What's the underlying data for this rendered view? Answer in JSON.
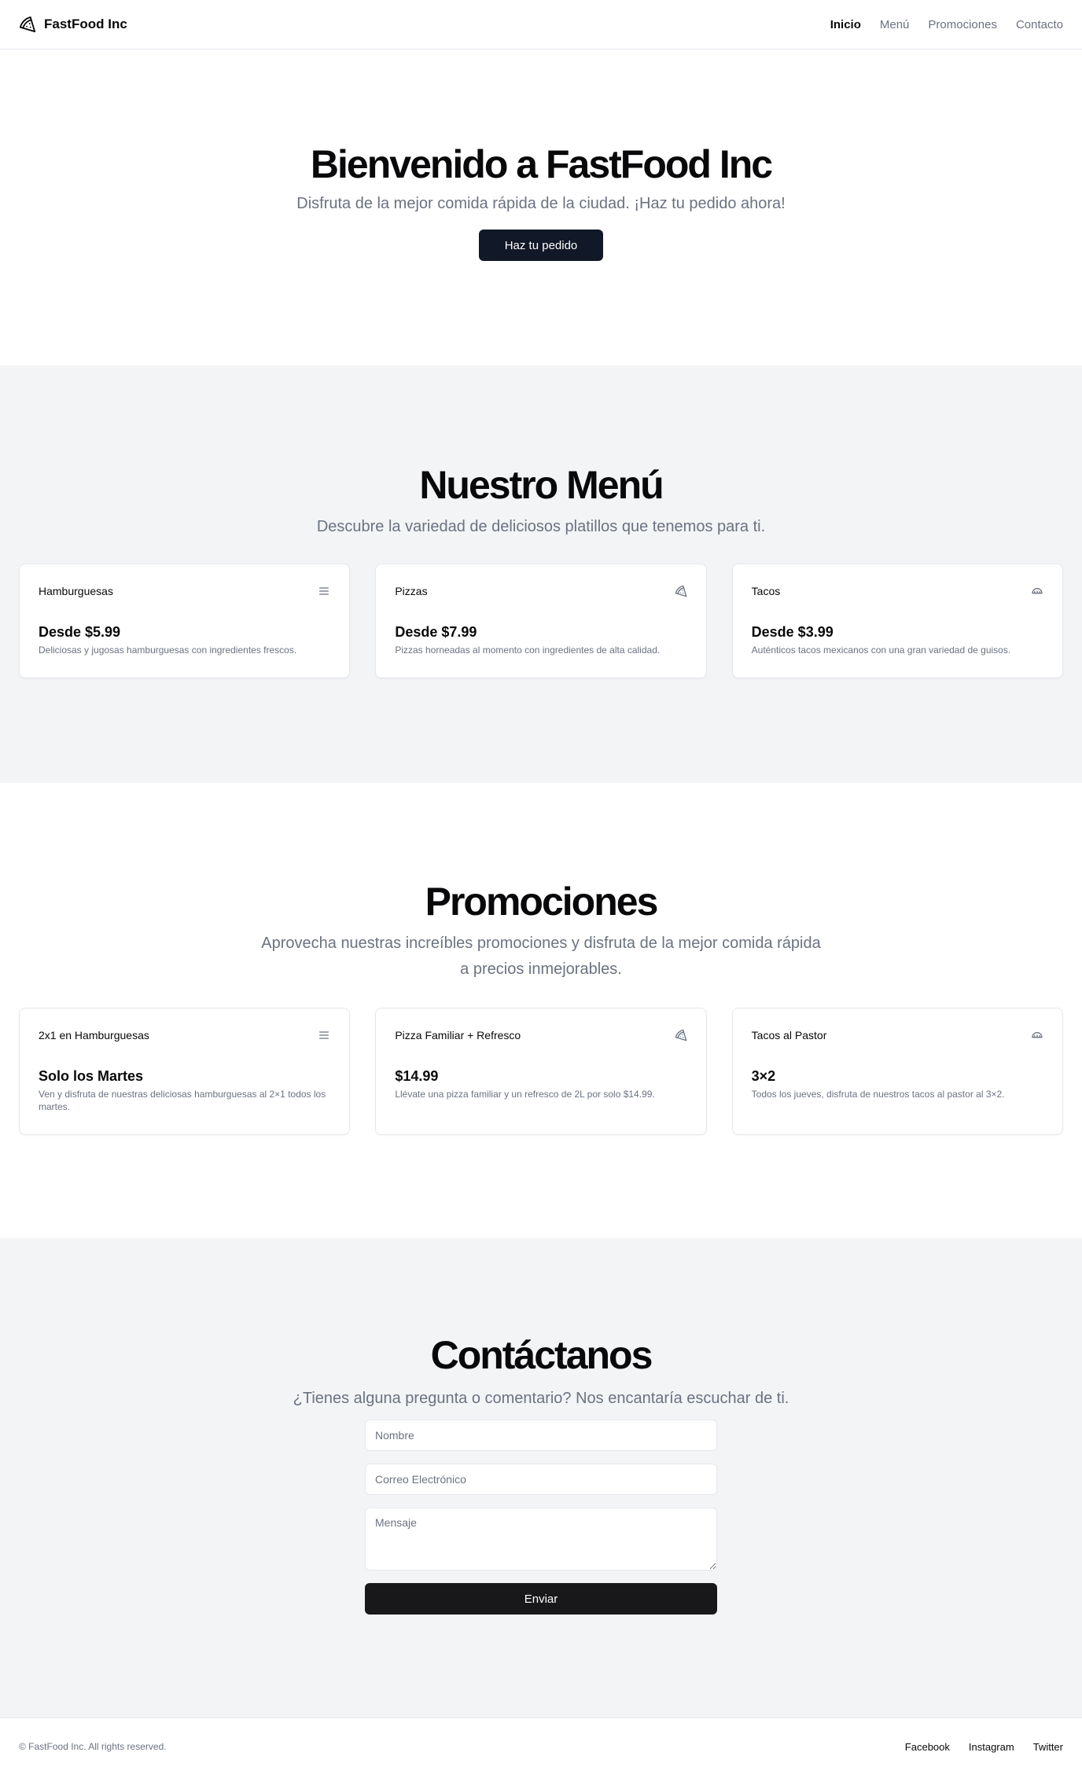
{
  "header": {
    "brand": "FastFood Inc",
    "nav": [
      "Inicio",
      "Menú",
      "Promociones",
      "Contacto"
    ]
  },
  "hero": {
    "title": "Bienvenido a FastFood Inc",
    "subtitle": "Disfruta de la mejor comida rápida de la ciudad. ¡Haz tu pedido ahora!",
    "cta": "Haz tu pedido"
  },
  "menu": {
    "title": "Nuestro Menú",
    "subtitle": "Descubre la variedad de deliciosos platillos que tenemos para ti.",
    "items": [
      {
        "name": "Hamburguesas",
        "icon": "menu-icon",
        "price": "Desde $5.99",
        "desc": "Deliciosas y jugosas hamburguesas con ingredientes frescos."
      },
      {
        "name": "Pizzas",
        "icon": "pizza-icon",
        "price": "Desde $7.99",
        "desc": "Pizzas horneadas al momento con ingredientes de alta calidad."
      },
      {
        "name": "Tacos",
        "icon": "taco-icon",
        "price": "Desde $3.99",
        "desc": "Auténticos tacos mexicanos con una gran variedad de guisos."
      }
    ]
  },
  "promos": {
    "title": "Promociones",
    "subtitle": "Aprovecha nuestras increíbles promociones y disfruta de la mejor comida rápida a precios inmejorables.",
    "items": [
      {
        "name": "2x1 en Hamburguesas",
        "icon": "menu-icon",
        "price": "Solo los Martes",
        "desc": "Ven y disfruta de nuestras deliciosas hamburguesas al 2×1 todos los martes."
      },
      {
        "name": "Pizza Familiar + Refresco",
        "icon": "pizza-icon",
        "price": "$14.99",
        "desc": "Llévate una pizza familiar y un refresco de 2L por solo $14.99."
      },
      {
        "name": "Tacos al Pastor",
        "icon": "taco-icon",
        "price": "3×2",
        "desc": "Todos los jueves, disfruta de nuestros tacos al pastor al 3×2."
      }
    ]
  },
  "contact": {
    "title": "Contáctanos",
    "subtitle": "¿Tienes alguna pregunta o comentario? Nos encantaría escuchar de ti.",
    "name_placeholder": "Nombre",
    "email_placeholder": "Correo Electrónico",
    "message_placeholder": "Mensaje",
    "submit": "Enviar"
  },
  "footer": {
    "copyright": "© FastFood Inc. All rights reserved.",
    "links": [
      "Facebook",
      "Instagram",
      "Twitter"
    ]
  }
}
